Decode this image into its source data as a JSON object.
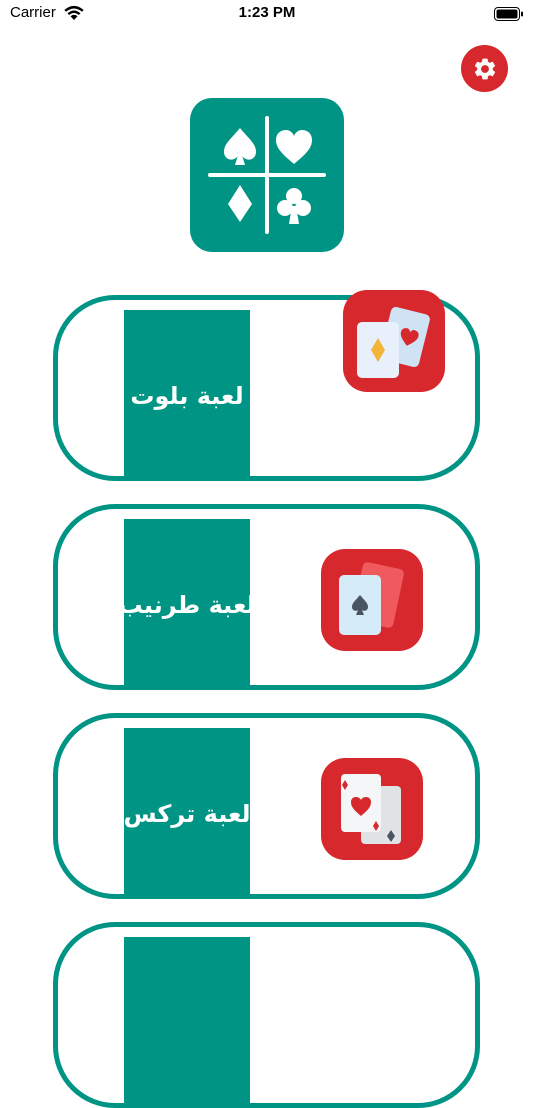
{
  "status_bar": {
    "carrier": "Carrier",
    "time": "1:23 PM"
  },
  "settings": {
    "icon": "gear-icon"
  },
  "logo": {
    "icon": "card-suits-icon",
    "suits": [
      "spade",
      "heart",
      "diamond",
      "club"
    ]
  },
  "games": [
    {
      "label": "لعبة بلوت",
      "icon": "diamond-heart-cards-icon"
    },
    {
      "label": "لعبة طرنيب",
      "icon": "spade-card-icon"
    },
    {
      "label": "لعبة تركس",
      "icon": "heart-diamond-cards-icon"
    },
    {
      "label": "",
      "icon": ""
    }
  ],
  "colors": {
    "primary": "#009485",
    "accent": "#d7282d",
    "background": "#ffffff"
  }
}
